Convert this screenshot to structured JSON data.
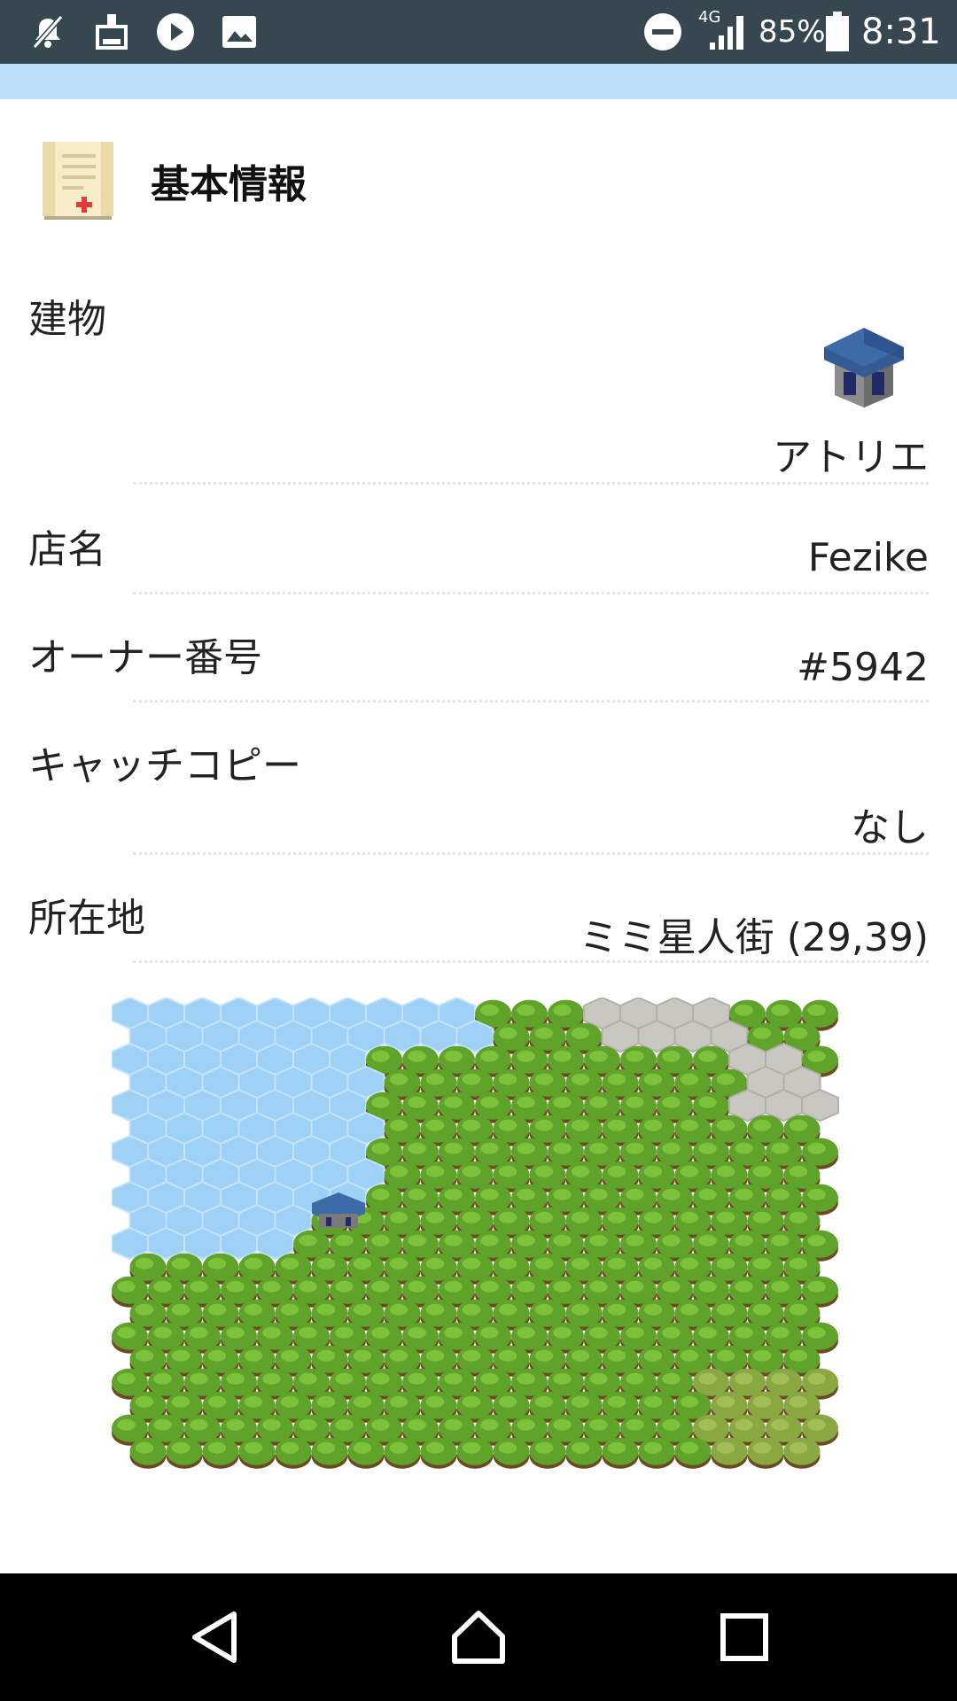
{
  "status_bar": {
    "network": "4G",
    "battery": "85%",
    "time": "8:31"
  },
  "header": {
    "title": "基本情報",
    "icon": "scroll-icon"
  },
  "rows": [
    {
      "label": "建物",
      "value": "アトリエ",
      "icon": "building-icon"
    },
    {
      "label": "店名",
      "value": "Fezike"
    },
    {
      "label": "オーナー番号",
      "value": "#5942"
    },
    {
      "label": "キャッチコピー",
      "value": "なし"
    },
    {
      "label": "所在地",
      "value": "ミミ星人街 (29,39)"
    }
  ],
  "map": {
    "icon": "hex-map-thumbnail",
    "colors": {
      "water": "#9fd0f5",
      "forest": "#5fa32a",
      "road": "#c8c8c0",
      "bridge": "#a0642a",
      "meadow": "#8aa842"
    }
  },
  "nav": {
    "back": "back-icon",
    "home": "home-icon",
    "recents": "recents-icon"
  }
}
